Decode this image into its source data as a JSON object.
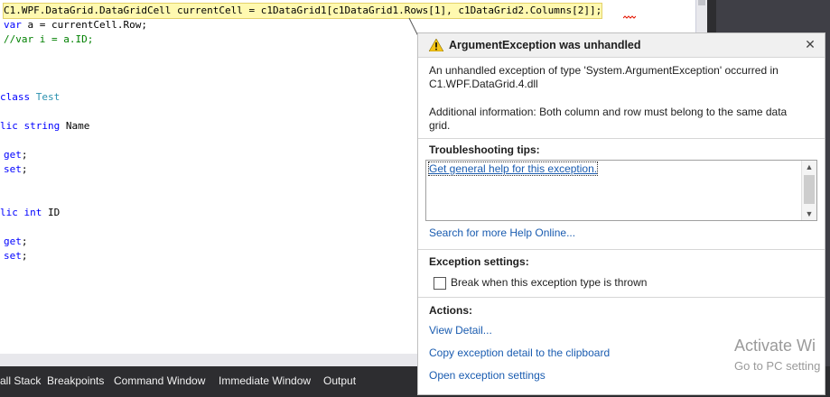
{
  "code": {
    "line1": {
      "type": "C1.WPF.DataGrid.DataGridCell",
      "rest": " currentCell = c1DataGrid1[c1DataGrid1.Rows[1], c1DataGrid2.Columns[2]];"
    },
    "line2": {
      "kw": "var",
      "rest": " a = currentCell.Row;"
    },
    "line3": "//var i = a.ID;",
    "line4": {
      "kw": "class",
      "rest": " Test"
    },
    "line5": {
      "kw": "lic string",
      "rest": " Name"
    },
    "line6": {
      "kw": "get",
      "rest": ";"
    },
    "line7": {
      "kw": "set",
      "rest": ";"
    },
    "line8": {
      "kw": "lic int",
      "rest": " ID"
    },
    "line9": {
      "kw": "get",
      "rest": ";"
    },
    "line10": {
      "kw": "set",
      "rest": ";"
    }
  },
  "dialog": {
    "title": "ArgumentException was unhandled",
    "close_glyph": "✕",
    "message": "An unhandled exception of type 'System.ArgumentException' occurred in C1.WPF.DataGrid.4.dll",
    "additional": "Additional information: Both column and row must belong to the same data grid.",
    "tips_heading": "Troubleshooting tips:",
    "tips_link": "Get general help for this exception.",
    "search_online": "Search for more Help Online...",
    "settings_heading": "Exception settings:",
    "break_label": "Break when this exception type is thrown",
    "break_checked": false,
    "actions_heading": "Actions:",
    "view_detail": "View Detail...",
    "copy_detail": "Copy exception detail to the clipboard",
    "open_settings": "Open exception settings"
  },
  "bottom_tabs": [
    "all Stack",
    "Breakpoints",
    "Command Window",
    "Immediate Window",
    "Output"
  ],
  "watermark": {
    "line1": "Activate Wi",
    "line2": "Go to PC setting"
  },
  "colors": {
    "accent_link": "#1a5cb0",
    "highlight": "#fff9b0",
    "warning": "#f5c518",
    "keyword": "#0000ff",
    "type": "#2b91af",
    "comment": "#008000"
  },
  "icons": {
    "warning": "warning-triangle-icon",
    "close": "close-icon"
  }
}
